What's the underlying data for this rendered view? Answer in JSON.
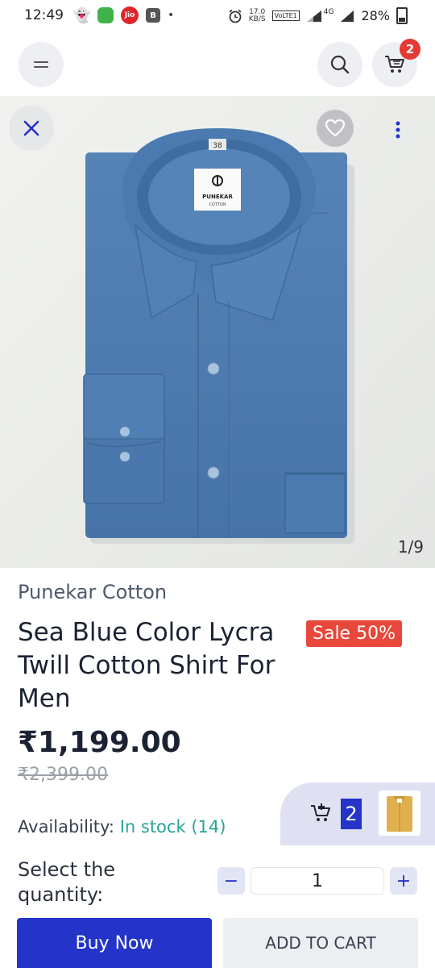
{
  "status_bar": {
    "time": "12:49",
    "jio_label": "Jio",
    "b_label": "B",
    "dot": "•",
    "net_speed_value": "17.0",
    "net_speed_unit": "KB/S",
    "volte_label": "VoLTE1",
    "network": "4G",
    "battery": "28%"
  },
  "header": {
    "cart_count": "2"
  },
  "gallery": {
    "counter": "1/9",
    "collar_size": "38",
    "label_brand": "PUNEKAR",
    "label_sub": "COTTON",
    "shirt_color": "#4f7db0"
  },
  "product": {
    "brand": "Punekar Cotton",
    "title": "Sea Blue Color Lycra Twill Cotton Shirt For Men",
    "sale_badge": "Sale 50%",
    "price": "₹1,199.00",
    "old_price": "₹2,399.00",
    "availability_label": "Availability:",
    "stock_status": "In stock",
    "stock_count": "(14)"
  },
  "mini_cart": {
    "count": "2"
  },
  "quantity": {
    "label": "Select the quantity:",
    "value": "1",
    "minus": "−",
    "plus": "+"
  },
  "actions": {
    "buy_now": "Buy Now",
    "add_to_cart": "ADD TO CART"
  },
  "colors": {
    "accent": "#2433c8",
    "sale": "#e8473b",
    "stock_green": "#2aa39a",
    "badge_red": "#e53935"
  }
}
